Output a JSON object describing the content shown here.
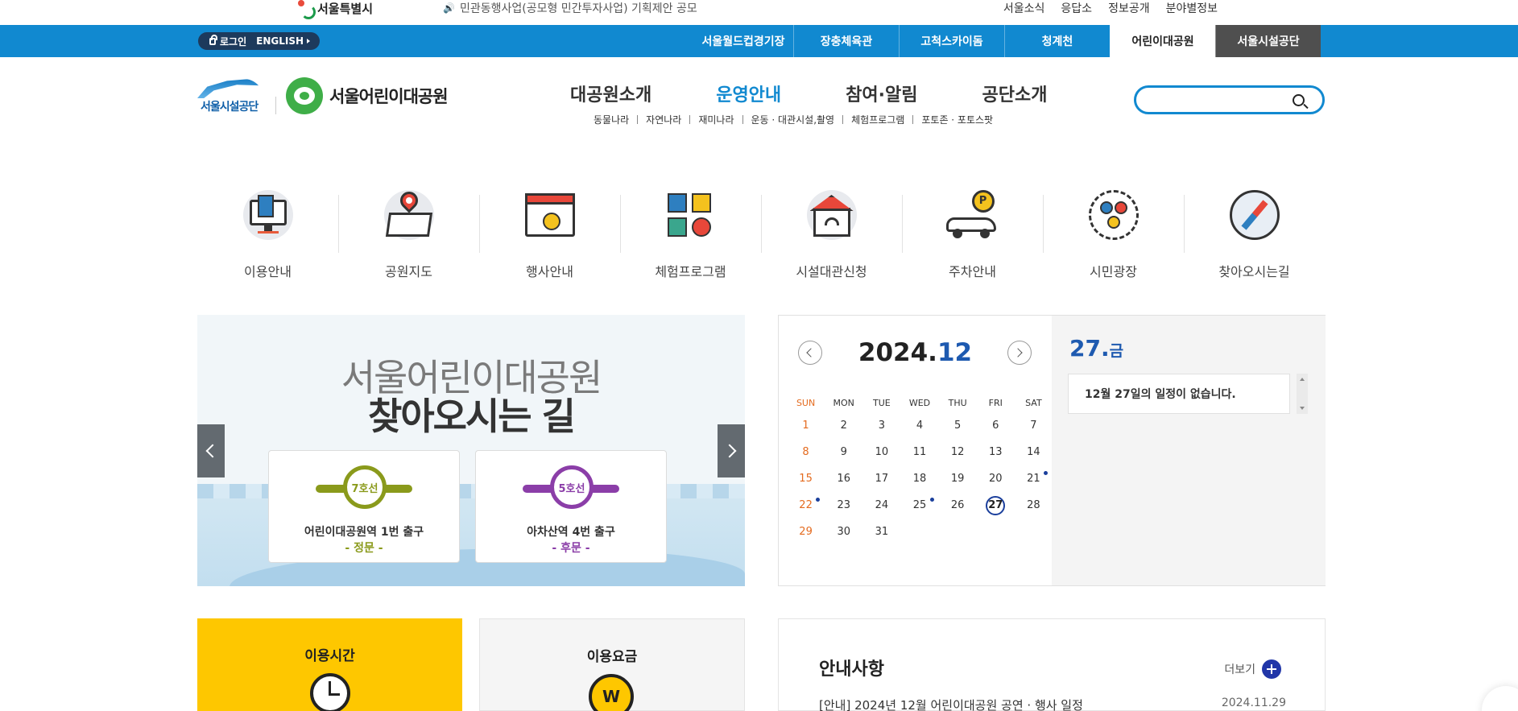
{
  "top_bar": {
    "seoul_logo": "서울특별시",
    "notice": "민관동행사업(공모형 민간투자사업) 기획제안 공모",
    "links": [
      "서울소식",
      "응답소",
      "정보공개",
      "분야별정보"
    ]
  },
  "blue_bar": {
    "login": "로그인",
    "english": "ENGLISH",
    "sites": [
      "서울월드컵경기장",
      "장충체육관",
      "고척스카이돔",
      "청계천",
      "어린이대공원",
      "서울시설공단"
    ]
  },
  "header": {
    "org_logo": "서울시설공단",
    "park_name": "서울어린이대공원",
    "gnb": [
      "대공원소개",
      "운영안내",
      "참여·알림",
      "공단소개"
    ],
    "sub_gnb": [
      "동물나라",
      "자연나라",
      "재미나라",
      "운동 · 대관시설,촬영",
      "체험프로그램",
      "포토존 · 포토스팟"
    ],
    "search_placeholder": ""
  },
  "quick_menu": [
    "이용안내",
    "공원지도",
    "행사안내",
    "체험프로그램",
    "시설대관신청",
    "주차안내",
    "시민광장",
    "찾아오시는길"
  ],
  "banner": {
    "title1": "서울어린이대공원",
    "title2": "찾아오시는 길",
    "cards": [
      {
        "line": "7호선",
        "station": "어린이대공원역 1번 출구",
        "gate": "- 정문 -",
        "color": "#8a9a1b"
      },
      {
        "line": "5호선",
        "station": "아차산역 4번 출구",
        "gate": "- 후문 -",
        "color": "#8b3ea8"
      }
    ]
  },
  "calendar": {
    "year": "2024.",
    "month": "12",
    "weekdays": [
      "SUN",
      "MON",
      "TUE",
      "WED",
      "THU",
      "FRI",
      "SAT"
    ],
    "weeks": [
      [
        "1",
        "2",
        "3",
        "4",
        "5",
        "6",
        "7"
      ],
      [
        "8",
        "9",
        "10",
        "11",
        "12",
        "13",
        "14"
      ],
      [
        "15",
        "16",
        "17",
        "18",
        "19",
        "20",
        "21"
      ],
      [
        "22",
        "23",
        "24",
        "25",
        "26",
        "27",
        "28"
      ],
      [
        "29",
        "30",
        "31",
        "",
        "",
        "",
        ""
      ]
    ],
    "selected_day": "27.",
    "selected_weekday": "금",
    "schedule_text": "12월 27일의 일정이 없습니다."
  },
  "hours": {
    "title": "이용시간"
  },
  "fees": {
    "title": "이용요금",
    "icon_text": "W"
  },
  "notice": {
    "title": "안내사항",
    "more": "더보기",
    "items": [
      {
        "title": "[안내] 2024년 12월 어린이대공원 공연 · 행사 일정",
        "date": "2024.11.29"
      }
    ]
  }
}
